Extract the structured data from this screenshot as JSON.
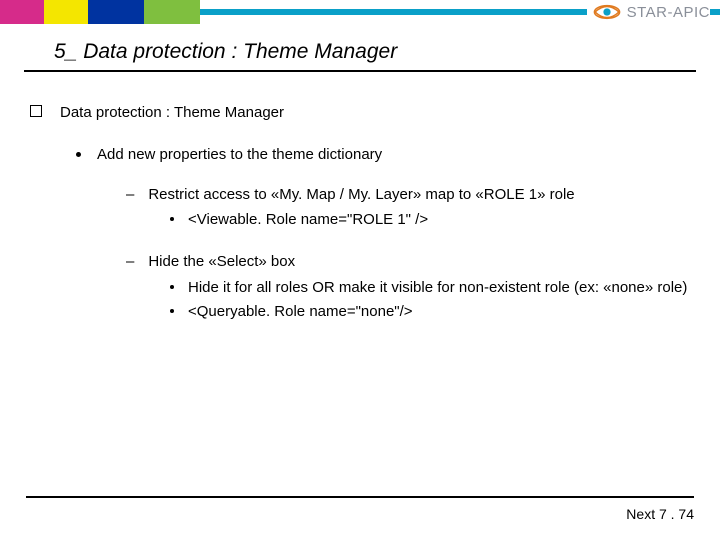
{
  "brand": {
    "name": "STAR-APIC"
  },
  "title": "5_ Data protection : Theme Manager",
  "bullets": {
    "main": "Data protection : Theme Manager",
    "sub": "Add new properties to the theme dictionary",
    "restrict": {
      "line": "Restrict access to «My. Map / My. Layer» map to «ROLE 1» role",
      "code": "<Viewable. Role name=\"ROLE 1\" />"
    },
    "hide": {
      "line": "Hide the «Select» box",
      "detail": "Hide it for all roles OR make it visible for non-existent role (ex: «none» role)",
      "code": "<Queryable. Role name=\"none\"/>"
    }
  },
  "footer": "Next 7 . 74"
}
